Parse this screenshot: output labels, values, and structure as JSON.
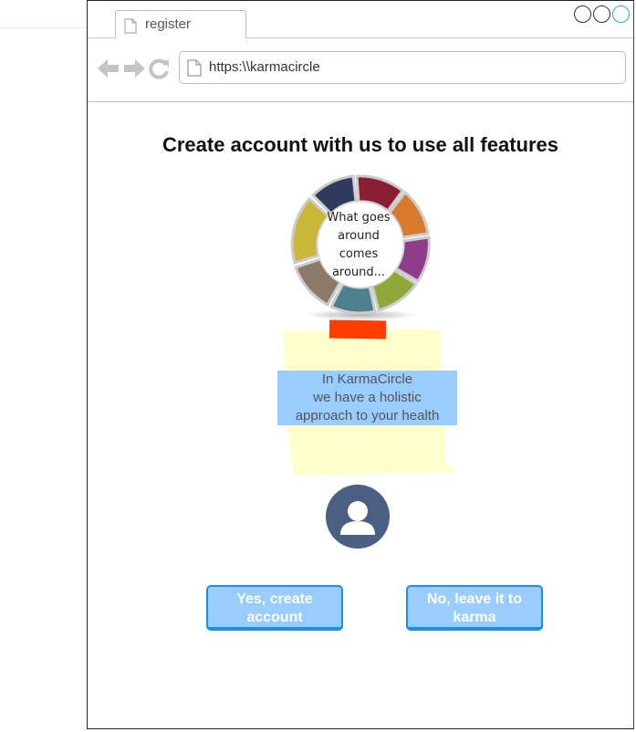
{
  "browser": {
    "tab_title": "register",
    "url": "https:\\\\karmacircle"
  },
  "page": {
    "heading": "Create account with us to use all features",
    "logo_lines": [
      "What goes",
      "around",
      "comes",
      "around..."
    ],
    "callout_lines": [
      "In KarmaCircle",
      "we have a holistic",
      "approach to your health"
    ],
    "buttons": {
      "yes_line1": "Yes, create",
      "yes_line2": "account",
      "no_line1": "No, leave it to",
      "no_line2": "karma"
    }
  },
  "colors": {
    "sticky_note": "#ffffcc",
    "tape": "#ff3b00",
    "callout": "#99ccff",
    "button_fill": "#99ccff",
    "button_border": "#1f8ee8",
    "avatar_bg": "#4b5f83"
  },
  "icons": [
    "document-icon",
    "back-arrow-icon",
    "forward-arrow-icon",
    "reload-icon",
    "user-avatar-icon",
    "window-control-icon"
  ]
}
